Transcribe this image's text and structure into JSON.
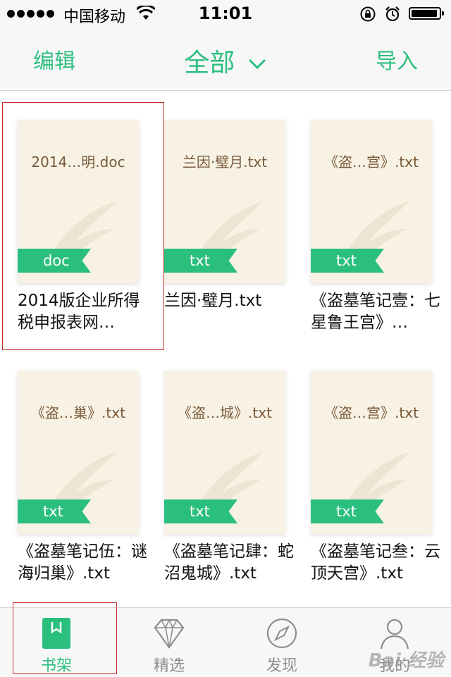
{
  "status": {
    "carrier": "中国移动",
    "time": "11:01"
  },
  "nav": {
    "left": "编辑",
    "title": "全部",
    "right": "导入"
  },
  "books": [
    {
      "cover_title": "2014…明.doc",
      "tag": "doc",
      "name": "2014版企业所得税申报表网…"
    },
    {
      "cover_title": "兰因·璧月.txt",
      "tag": "txt",
      "name": "兰因·璧月.txt"
    },
    {
      "cover_title": "《盗…宫》.txt",
      "tag": "txt",
      "name": "《盗墓笔记壹：七星鲁王宫》…"
    },
    {
      "cover_title": "《盗…巢》.txt",
      "tag": "txt",
      "name": "《盗墓笔记伍：谜海归巢》.txt"
    },
    {
      "cover_title": "《盗…城》.txt",
      "tag": "txt",
      "name": "《盗墓笔记肆：蛇沼鬼城》.txt"
    },
    {
      "cover_title": "《盗…宫》.txt",
      "tag": "txt",
      "name": "《盗墓笔记叁：云顶天宫》.txt"
    }
  ],
  "tabs": [
    {
      "label": "书架"
    },
    {
      "label": "精选"
    },
    {
      "label": "发现"
    },
    {
      "label": "我的"
    }
  ],
  "watermark": "Bai 经验",
  "colors": {
    "accent": "#2bbf7e",
    "cover": "#f7f2e4",
    "highlight": "#c9302c"
  }
}
